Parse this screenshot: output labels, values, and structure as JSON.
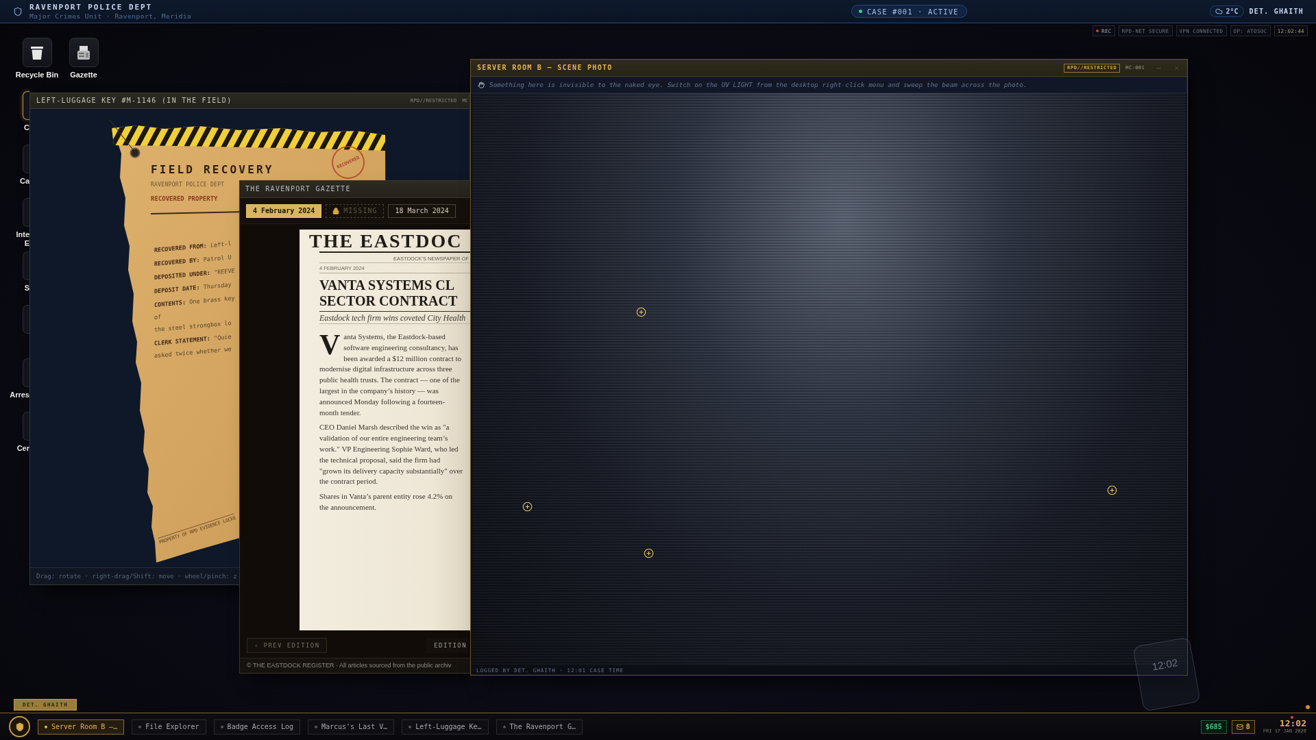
{
  "top_bar": {
    "title": "RAVENPORT POLICE DEPT",
    "subtitle": "Major Crimes Unit · Ravenport, Meridia",
    "case": {
      "label": "CASE #001 · ACTIVE",
      "active": true
    },
    "weather": "2°C",
    "user": "DET. GHAITH"
  },
  "status_chips": [
    {
      "kind": "rec",
      "label": "REC"
    },
    {
      "kind": "plain",
      "label": "RPD-NET SECURE"
    },
    {
      "kind": "plain",
      "label": "VPN CONNECTED"
    },
    {
      "kind": "plain",
      "label": "OP: ATOSOC"
    },
    {
      "kind": "clock",
      "label": "12:02:44"
    }
  ],
  "desktop_icons": [
    {
      "kind": "trash",
      "label": "Recycle Bin",
      "selected": false
    },
    {
      "kind": "newspaper",
      "label": "Gazette",
      "selected": false
    }
  ],
  "covered_desktop_icons": [
    {
      "label_lines": [
        "C"
      ],
      "selected": true
    },
    {
      "label_lines": [
        "Ca"
      ],
      "selected": false
    },
    {
      "label_lines": [
        "Inte",
        "E"
      ],
      "selected": false
    },
    {
      "label_lines": [
        "S"
      ],
      "selected": false
    },
    {
      "selected": false
    },
    {
      "label_lines": [
        "Arres"
      ],
      "selected": false
    },
    {
      "label_lines": [
        "Cer"
      ],
      "selected": false
    }
  ],
  "evidence_window": {
    "title": "LEFT-LUGGAGE KEY #M-1146 (IN THE FIELD)",
    "classification": "RPD//RESTRICTED",
    "ref": "MC",
    "tag": {
      "heading": "FIELD RECOVERY",
      "issuer": "RAVENPORT POLICE DEPT",
      "section": "RECOVERED PROPERTY",
      "stamp": "RECOVERED",
      "fields": [
        {
          "lines": [
            "**RECOVERED FROM:** Left-l"
          ]
        },
        {
          "lines": [
            "**RECOVERED BY:** Patrol U"
          ]
        },
        {
          "lines": [
            "**DEPOSITED UNDER:** \"REEVE"
          ]
        },
        {
          "lines": [
            "**DEPOSIT DATE:** Thursday"
          ]
        },
        {
          "lines": [
            "**CONTENTS:** One brass key",
            "of",
            "the steel strongbox lo"
          ]
        },
        {
          "lines": [
            "**CLERK STATEMENT:** \"Quie",
            "asked twice whether we"
          ]
        }
      ],
      "footer": "PROPERTY OF RPD EVIDENCE LOCKE"
    },
    "hint": "Drag: rotate · right-drag/Shift: move · wheel/pinch: z"
  },
  "gazette_window": {
    "title": "THE RAVENPORT GAZETTE",
    "editions": [
      {
        "label": "4 February 2024",
        "selected": true,
        "locked": false
      },
      {
        "label": "MISSING",
        "selected": false,
        "locked": true
      },
      {
        "label": "18 March 2024",
        "selected": false,
        "locked": false
      }
    ],
    "page": {
      "masthead": "THE EASTDOC",
      "tagline": "EASTDOCK’S NEWSPAPER OF",
      "dateline": "4 FEBRUARY 2024",
      "headline_lines": [
        "VANTA SYSTEMS CL",
        "SECTOR CONTRACT"
      ],
      "standfirst": "Eastdock tech firm wins coveted City Health",
      "paragraphs": [
        "Vanta Systems, the Eastdock-based software engineering consultancy, has been awarded a $12 million contract to modernise digital infrastructure across three public health trusts. The contract — one of the largest in the company’s history — was announced Monday following a fourteen-month tender.",
        "CEO Daniel Marsh described the win as \"a validation of our entire engineering team’s work.\" VP Engineering Sophie Ward, who led the technical proposal, said the firm had \"grown its delivery capacity substantially\" over the contract period.",
        "Shares in Vanta’s parent entity rose 4.2% on the announcement."
      ]
    },
    "nav_buttons": [
      {
        "label": "‹ PREV EDITION",
        "disabled": true
      },
      {
        "label": "EDITION",
        "disabled": false
      }
    ],
    "credit": "© THE EASTDOCK REGISTER · All articles sourced from the public archiv"
  },
  "photo_window": {
    "title": "SERVER ROOM B — SCENE PHOTO",
    "classification": "RPD//RESTRICTED",
    "ref": "MC-001",
    "hint": "Something here is invisible to the naked eye. Switch on the UV LIGHT from the desktop right-click menu and sweep the beam across the photo.",
    "footer": "LOGGED BY DET. GHAITH · 12:01 CASE TIME"
  },
  "phone": {
    "clock": "12:02"
  },
  "desk_tag": "DET. GHAITH",
  "taskbar": {
    "tasks": [
      {
        "label": "Server Room B —…",
        "selected": true
      },
      {
        "label": "File Explorer",
        "selected": false
      },
      {
        "label": "Badge Access Log",
        "selected": false
      },
      {
        "label": "Marcus's Last V…",
        "selected": false
      },
      {
        "label": "Left-Luggage Ke…",
        "selected": false
      },
      {
        "label": "The Ravenport G…",
        "selected": false
      }
    ],
    "balance": "$685",
    "messages": "8",
    "clock": "12:02",
    "date": "FRI 17 JAN 2020",
    "alert": true
  }
}
